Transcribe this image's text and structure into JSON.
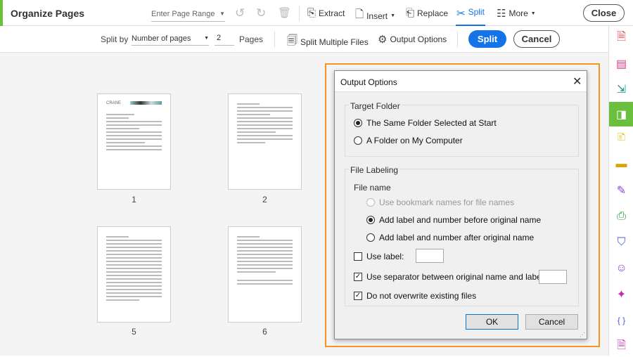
{
  "topbar": {
    "title": "Organize Pages",
    "page_range_placeholder": "Enter Page Range",
    "extract": "Extract",
    "insert": "Insert",
    "replace": "Replace",
    "split": "Split",
    "more": "More",
    "close": "Close"
  },
  "subbar": {
    "split_by_label": "Split by",
    "split_by_value": "Number of pages",
    "pages_value": "2",
    "pages_label": "Pages",
    "split_multiple": "Split Multiple Files",
    "output_options": "Output Options",
    "split_button": "Split",
    "cancel_button": "Cancel"
  },
  "pages": [
    {
      "label": "1"
    },
    {
      "label": "2"
    },
    {
      "label": "5"
    },
    {
      "label": "6"
    }
  ],
  "thumb_header": "CRANE",
  "dialog": {
    "title": "Output Options",
    "target_folder": "Target Folder",
    "same_folder": "The Same Folder Selected at Start",
    "other_folder": "A Folder on My Computer",
    "file_labeling": "File Labeling",
    "file_name": "File name",
    "use_bookmark": "Use bookmark names for file names",
    "before": "Add label and number before original name",
    "after": "Add label and number after original name",
    "use_label": "Use label:",
    "use_separator": "Use separator between original name and label:",
    "no_overwrite": "Do not overwrite existing files",
    "ok": "OK",
    "cancel": "Cancel"
  },
  "colors": {
    "accent": "#1473e6",
    "highlight": "#f7931e",
    "green": "#6bbf3f"
  }
}
